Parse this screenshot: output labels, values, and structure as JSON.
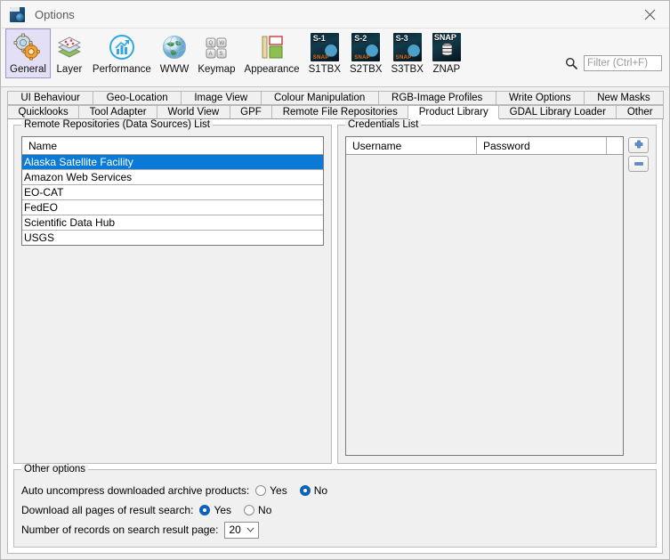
{
  "window": {
    "title": "Options",
    "icon": "snap-app-icon",
    "close_label": "×"
  },
  "categories": [
    {
      "label": "General",
      "icon": "gears-icon",
      "selected": true
    },
    {
      "label": "Layer",
      "icon": "layers-icon",
      "selected": false
    },
    {
      "label": "Performance",
      "icon": "performance-icon",
      "selected": false
    },
    {
      "label": "WWW",
      "icon": "globe-icon",
      "selected": false
    },
    {
      "label": "Keymap",
      "icon": "keyboard-icon",
      "selected": false
    },
    {
      "label": "Appearance",
      "icon": "appearance-icon",
      "selected": false
    },
    {
      "label": "S1TBX",
      "icon": "sentinel1-icon",
      "selected": false,
      "tag": "S-1"
    },
    {
      "label": "S2TBX",
      "icon": "sentinel2-icon",
      "selected": false,
      "tag": "S-2"
    },
    {
      "label": "S3TBX",
      "icon": "sentinel3-icon",
      "selected": false,
      "tag": "S-3"
    },
    {
      "label": "ZNAP",
      "icon": "znap-icon",
      "selected": false,
      "tag": "SNAP"
    }
  ],
  "filter": {
    "placeholder": "Filter (Ctrl+F)",
    "value": "",
    "icon": "search-icon"
  },
  "tabs": {
    "row1": [
      {
        "label": "UI Behaviour",
        "selected": false
      },
      {
        "label": "Geo-Location",
        "selected": false
      },
      {
        "label": "Image View",
        "selected": false
      },
      {
        "label": "Colour Manipulation",
        "selected": false
      },
      {
        "label": "RGB-Image Profiles",
        "selected": false
      },
      {
        "label": "Write Options",
        "selected": false
      },
      {
        "label": "New Masks",
        "selected": false
      }
    ],
    "row2": [
      {
        "label": "Quicklooks",
        "selected": false
      },
      {
        "label": "Tool Adapter",
        "selected": false
      },
      {
        "label": "World View",
        "selected": false
      },
      {
        "label": "GPF",
        "selected": false
      },
      {
        "label": "Remote File Repositories",
        "selected": false
      },
      {
        "label": "Product Library",
        "selected": true
      },
      {
        "label": "GDAL Library Loader",
        "selected": false
      },
      {
        "label": "Other",
        "selected": false
      }
    ]
  },
  "repositories_panel": {
    "title": "Remote Repositories (Data Sources) List",
    "column_header": "Name",
    "rows": [
      {
        "name": "Alaska Satellite Facility",
        "selected": true
      },
      {
        "name": "Amazon Web Services",
        "selected": false
      },
      {
        "name": "EO-CAT",
        "selected": false
      },
      {
        "name": "FedEO",
        "selected": false
      },
      {
        "name": "Scientific Data Hub",
        "selected": false
      },
      {
        "name": "USGS",
        "selected": false
      }
    ]
  },
  "credentials_panel": {
    "title": "Credentials List",
    "columns": [
      "Username",
      "Password"
    ],
    "rows": [],
    "add_button": "add-credential-button",
    "remove_button": "remove-credential-button"
  },
  "other_options": {
    "title": "Other options",
    "rows": [
      {
        "label": "Auto uncompress downloaded archive products:",
        "options": [
          {
            "label": "Yes",
            "selected": false
          },
          {
            "label": "No",
            "selected": true
          }
        ]
      },
      {
        "label": "Download all pages of result search:",
        "options": [
          {
            "label": "Yes",
            "selected": true
          },
          {
            "label": "No",
            "selected": false
          }
        ]
      }
    ],
    "records_row": {
      "label": "Number of records on search result page:",
      "value": "20"
    }
  },
  "colors": {
    "selection_blue": "#0a7ad6",
    "radio_blue": "#0a62c0",
    "selected_category_bg": "#e3dff4",
    "selected_category_border": "#9f95c9",
    "window_bg": "#f0f0f0",
    "titlebar_bg": "#f6f6f6"
  }
}
